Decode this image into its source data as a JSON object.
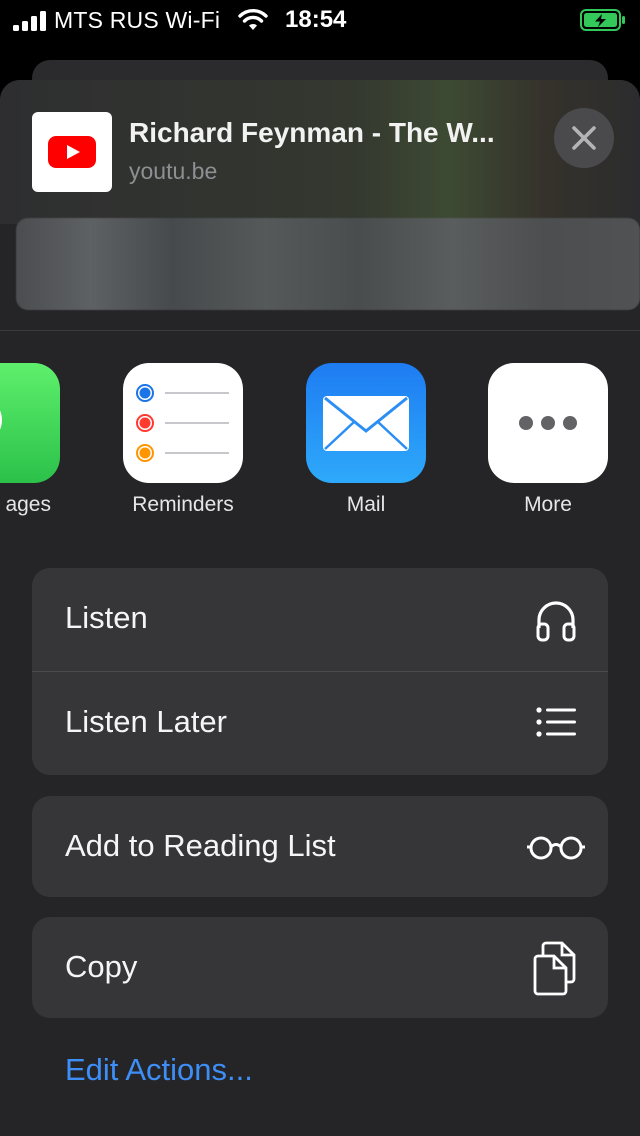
{
  "status_bar": {
    "carrier": "MTS RUS Wi-Fi",
    "time": "18:54",
    "battery_status": "charging"
  },
  "share_header": {
    "title": "Richard Feynman - The W...",
    "url": "youtu.be",
    "app_icon": "youtube-logo-icon",
    "close_icon": "close-icon"
  },
  "apps": [
    {
      "label": "Messages",
      "visible_label": "ages",
      "icon": "messages-icon"
    },
    {
      "label": "Reminders",
      "icon": "reminders-icon"
    },
    {
      "label": "Mail",
      "icon": "mail-icon"
    },
    {
      "label": "More",
      "icon": "more-icon"
    }
  ],
  "actions": {
    "listen": {
      "label": "Listen",
      "icon": "headphones-icon"
    },
    "listen_later": {
      "label": "Listen Later",
      "icon": "list-icon"
    },
    "reading_list": {
      "label": "Add to Reading List",
      "icon": "glasses-icon"
    },
    "copy": {
      "label": "Copy",
      "icon": "copy-icon"
    }
  },
  "edit_actions": {
    "label": "Edit Actions..."
  },
  "colors": {
    "sheet_bg": "#252527",
    "group_bg": "#363638",
    "link_blue": "#3d8ef7",
    "battery_green": "#34c759",
    "youtube_red": "#ff0000"
  }
}
